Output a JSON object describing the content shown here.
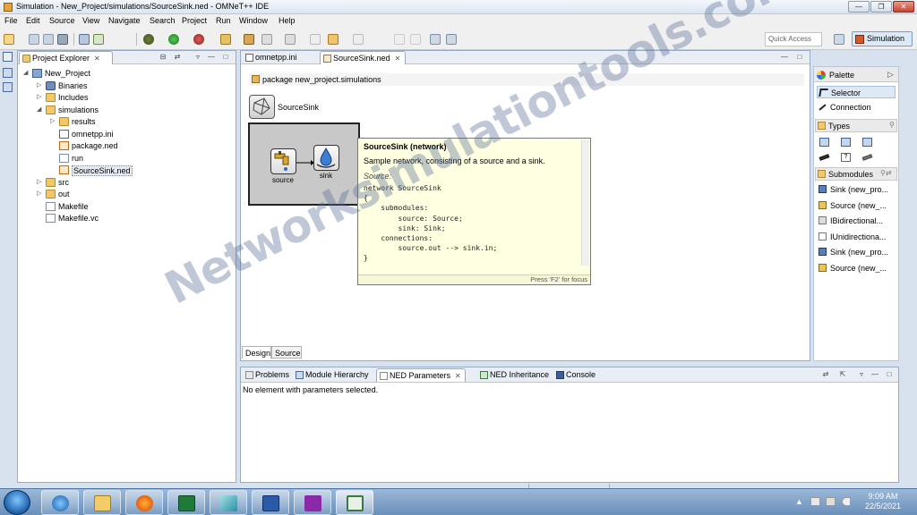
{
  "window": {
    "title": "Simulation - New_Project/simulations/SourceSink.ned - OMNeT++ IDE"
  },
  "menu": [
    "File",
    "Edit",
    "Source",
    "View",
    "Navigate",
    "Search",
    "Project",
    "Run",
    "Window",
    "Help"
  ],
  "toolbar": {
    "quick_access": "Quick Access",
    "perspective": "Simulation"
  },
  "project_explorer": {
    "tab": "Project Explorer",
    "tree": [
      {
        "label": "New_Project",
        "kind": "project",
        "depth": 0,
        "expand": "◢"
      },
      {
        "label": "Binaries",
        "kind": "binaries",
        "depth": 1,
        "expand": "▷"
      },
      {
        "label": "Includes",
        "kind": "includes",
        "depth": 1,
        "expand": "▷"
      },
      {
        "label": "simulations",
        "kind": "folder",
        "depth": 1,
        "expand": "◢"
      },
      {
        "label": "results",
        "kind": "folder",
        "depth": 2,
        "expand": "▷"
      },
      {
        "label": "omnetpp.ini",
        "kind": "ini",
        "depth": 2,
        "expand": ""
      },
      {
        "label": "package.ned",
        "kind": "ned",
        "depth": 2,
        "expand": ""
      },
      {
        "label": "run",
        "kind": "txt",
        "depth": 2,
        "expand": ""
      },
      {
        "label": "SourceSink.ned",
        "kind": "ned",
        "depth": 2,
        "expand": "",
        "selected": true
      },
      {
        "label": "src",
        "kind": "folder",
        "depth": 1,
        "expand": "▷"
      },
      {
        "label": "out",
        "kind": "folder",
        "depth": 1,
        "expand": "▷"
      },
      {
        "label": "Makefile",
        "kind": "txt",
        "depth": 1,
        "expand": ""
      },
      {
        "label": "Makefile.vc",
        "kind": "txt",
        "depth": 1,
        "expand": ""
      }
    ]
  },
  "editor": {
    "tabs": [
      {
        "label": "omnetpp.ini",
        "active": false
      },
      {
        "label": "SourceSink.ned",
        "active": true
      }
    ],
    "package_line": "package new_project.simulations",
    "network_name": "SourceSink",
    "modules": [
      {
        "label": "source"
      },
      {
        "label": "sink"
      }
    ],
    "bottom_tabs": [
      "Design",
      "Source"
    ]
  },
  "tooltip": {
    "heading": "SourceSink (network)",
    "description": "Sample network, consisting of a source and a sink.",
    "source_label": "Source:",
    "code": "network SourceSink\n{\n    submodules:\n        source: Source;\n        sink: Sink;\n    connections:\n        source.out --> sink.in;\n}",
    "footer": "Press 'F2' for focus"
  },
  "palette": {
    "title": "Palette",
    "tools": [
      {
        "label": "Selector",
        "selected": true
      },
      {
        "label": "Connection",
        "selected": false
      }
    ],
    "types_section": "Types",
    "submodules_section": "Submodules",
    "submodules": [
      "Sink (new_pro...",
      "Source (new_...",
      "IBidirectional...",
      "IUnidirectiona...",
      "Sink (new_pro...",
      "Source (new_..."
    ]
  },
  "bottom_panel": {
    "tabs": [
      "Problems",
      "Module Hierarchy",
      "NED Parameters",
      "NED Inheritance",
      "Console"
    ],
    "active_tab": "NED Parameters",
    "message": "No element with parameters selected."
  },
  "taskbar": {
    "time": "9:09 AM",
    "date": "22/5/2021"
  },
  "watermark": "Networksimulationtools.com"
}
